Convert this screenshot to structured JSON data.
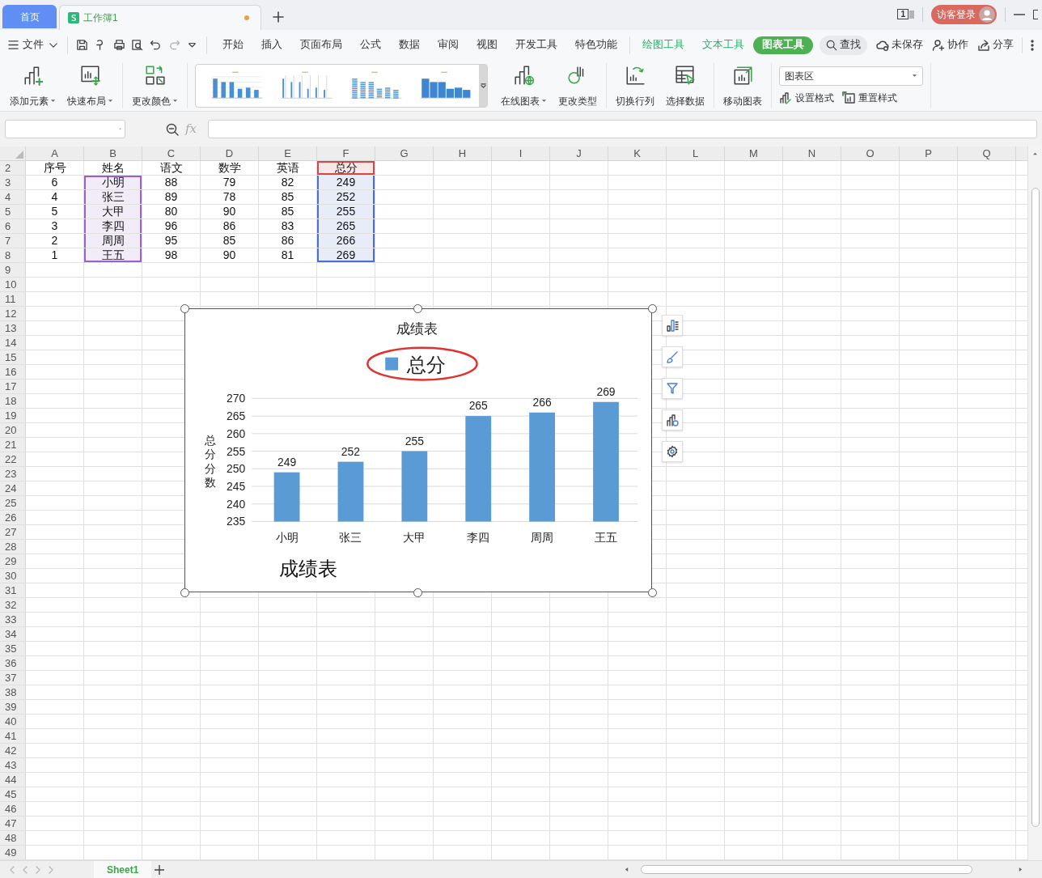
{
  "tabs": [
    {
      "label": "首页",
      "kind": "home",
      "selected": false
    },
    {
      "label": "工作簿1",
      "kind": "spreadsheet",
      "selected": true,
      "unsaved": true
    }
  ],
  "title_bar": {
    "page_count": "1",
    "login": "访客登录"
  },
  "menu": {
    "file": "文件",
    "tabs": [
      {
        "label": "开始",
        "kind": "main",
        "selected": false
      },
      {
        "label": "插入",
        "kind": "main",
        "selected": false
      },
      {
        "label": "页面布局",
        "kind": "main",
        "selected": false
      },
      {
        "label": "公式",
        "kind": "main",
        "selected": false
      },
      {
        "label": "数据",
        "kind": "main",
        "selected": false
      },
      {
        "label": "审阅",
        "kind": "main",
        "selected": false
      },
      {
        "label": "视图",
        "kind": "main",
        "selected": false
      },
      {
        "label": "开发工具",
        "kind": "main",
        "selected": false
      },
      {
        "label": "特色功能",
        "kind": "main",
        "selected": false
      },
      {
        "label": "绘图工具",
        "kind": "context",
        "selected": false
      },
      {
        "label": "文本工具",
        "kind": "context",
        "selected": false
      },
      {
        "label": "图表工具",
        "kind": "context",
        "selected": true
      }
    ],
    "search": "查找",
    "actions": [
      {
        "label": "未保存",
        "kind": "cloud"
      },
      {
        "label": "协作",
        "kind": "collab"
      },
      {
        "label": "分享",
        "kind": "share"
      }
    ]
  },
  "ribbon": {
    "left_groups": [
      [
        {
          "label": "添加元素",
          "kind": "add-element",
          "dropdown": true
        },
        {
          "label": "快速布局",
          "kind": "layout",
          "dropdown": true
        }
      ],
      [
        {
          "label": "更改颜色",
          "kind": "colors",
          "dropdown": true
        }
      ]
    ],
    "chart_styles": [
      {
        "kind": "lines"
      },
      {
        "kind": "thin"
      },
      {
        "kind": "striped"
      },
      {
        "kind": "gradient"
      }
    ],
    "right_groups": [
      [
        {
          "label": "在线图表",
          "kind": "online",
          "dropdown": true
        },
        {
          "label": "更改类型",
          "kind": "type",
          "dropdown": false
        }
      ],
      [
        {
          "label": "切换行列",
          "kind": "switch",
          "dropdown": false
        },
        {
          "label": "选择数据",
          "kind": "select",
          "dropdown": false
        }
      ],
      [
        {
          "label": "移动图表",
          "kind": "move",
          "dropdown": false
        }
      ]
    ],
    "element_selector": "图表区",
    "format_buttons": [
      {
        "label": "设置格式",
        "kind": "format"
      },
      {
        "label": "重置样式",
        "kind": "reset"
      }
    ]
  },
  "formula_bar": {
    "function_label": "fx"
  },
  "sheet": {
    "columns": [
      {
        "label": "A",
        "kind": "plain"
      },
      {
        "label": "B",
        "kind": "category"
      },
      {
        "label": "C",
        "kind": "plain"
      },
      {
        "label": "D",
        "kind": "plain"
      },
      {
        "label": "E",
        "kind": "plain"
      },
      {
        "label": "F",
        "kind": "values"
      },
      {
        "label": "G",
        "kind": "plain"
      },
      {
        "label": "H",
        "kind": "plain"
      },
      {
        "label": "I",
        "kind": "plain"
      },
      {
        "label": "J",
        "kind": "plain"
      },
      {
        "label": "K",
        "kind": "plain"
      },
      {
        "label": "L",
        "kind": "plain"
      },
      {
        "label": "M",
        "kind": "plain"
      },
      {
        "label": "N",
        "kind": "plain"
      },
      {
        "label": "O",
        "kind": "plain"
      },
      {
        "label": "P",
        "kind": "plain"
      },
      {
        "label": "Q",
        "kind": "plain"
      }
    ],
    "rows": [
      {
        "number": "2",
        "cells": [
          "序号",
          "姓名",
          "语文",
          "数学",
          "英语",
          "总分"
        ]
      },
      {
        "number": "3",
        "cells": [
          "6",
          "小明",
          "88",
          "79",
          "82",
          "249"
        ]
      },
      {
        "number": "4",
        "cells": [
          "4",
          "张三",
          "89",
          "78",
          "85",
          "252"
        ]
      },
      {
        "number": "5",
        "cells": [
          "5",
          "大甲",
          "80",
          "90",
          "85",
          "255"
        ]
      },
      {
        "number": "6",
        "cells": [
          "3",
          "李四",
          "96",
          "86",
          "83",
          "265"
        ]
      },
      {
        "number": "7",
        "cells": [
          "2",
          "周周",
          "95",
          "85",
          "86",
          "266"
        ]
      },
      {
        "number": "8",
        "cells": [
          "1",
          "王五",
          "98",
          "90",
          "81",
          "269"
        ]
      },
      {
        "number": "9"
      },
      {
        "number": "10"
      },
      {
        "number": "11"
      },
      {
        "number": "12"
      },
      {
        "number": "13"
      },
      {
        "number": "14"
      },
      {
        "number": "15"
      },
      {
        "number": "16"
      },
      {
        "number": "17"
      },
      {
        "number": "18"
      },
      {
        "number": "19"
      },
      {
        "number": "20"
      },
      {
        "number": "21"
      },
      {
        "number": "22"
      },
      {
        "number": "23"
      },
      {
        "number": "24"
      },
      {
        "number": "25"
      },
      {
        "number": "26"
      },
      {
        "number": "27"
      },
      {
        "number": "28"
      },
      {
        "number": "29"
      },
      {
        "number": "30"
      },
      {
        "number": "31"
      },
      {
        "number": "32"
      },
      {
        "number": "33"
      },
      {
        "number": "34"
      },
      {
        "number": "35"
      },
      {
        "number": "36"
      },
      {
        "number": "37"
      },
      {
        "number": "38"
      },
      {
        "number": "39"
      },
      {
        "number": "40"
      },
      {
        "number": "41"
      },
      {
        "number": "42"
      },
      {
        "number": "43"
      },
      {
        "number": "44"
      },
      {
        "number": "45"
      },
      {
        "number": "46"
      },
      {
        "number": "47"
      },
      {
        "number": "48"
      },
      {
        "number": "49"
      }
    ]
  },
  "chart": {
    "selected": true,
    "legend_highlight": {
      "color": "#e0322f"
    },
    "chart_data": {
      "grid": true,
      "type": "bar",
      "title": "成绩表",
      "ylabel": "总分分数",
      "categories": [
        "小明",
        "张三",
        "大甲",
        "李四",
        "周周",
        "王五"
      ],
      "series": [
        {
          "name": "总分",
          "color": "#5b9bd5",
          "values": [
            249,
            252,
            255,
            265,
            266,
            269
          ]
        }
      ],
      "ylim": [
        235,
        270
      ],
      "yticks": [
        235,
        240,
        245,
        250,
        255,
        260,
        265,
        270
      ],
      "data_labels": true,
      "annotations": [
        {
          "text": "成绩表"
        }
      ]
    }
  },
  "sheet_tabs": [
    {
      "label": "Sheet1",
      "selected": true
    }
  ]
}
